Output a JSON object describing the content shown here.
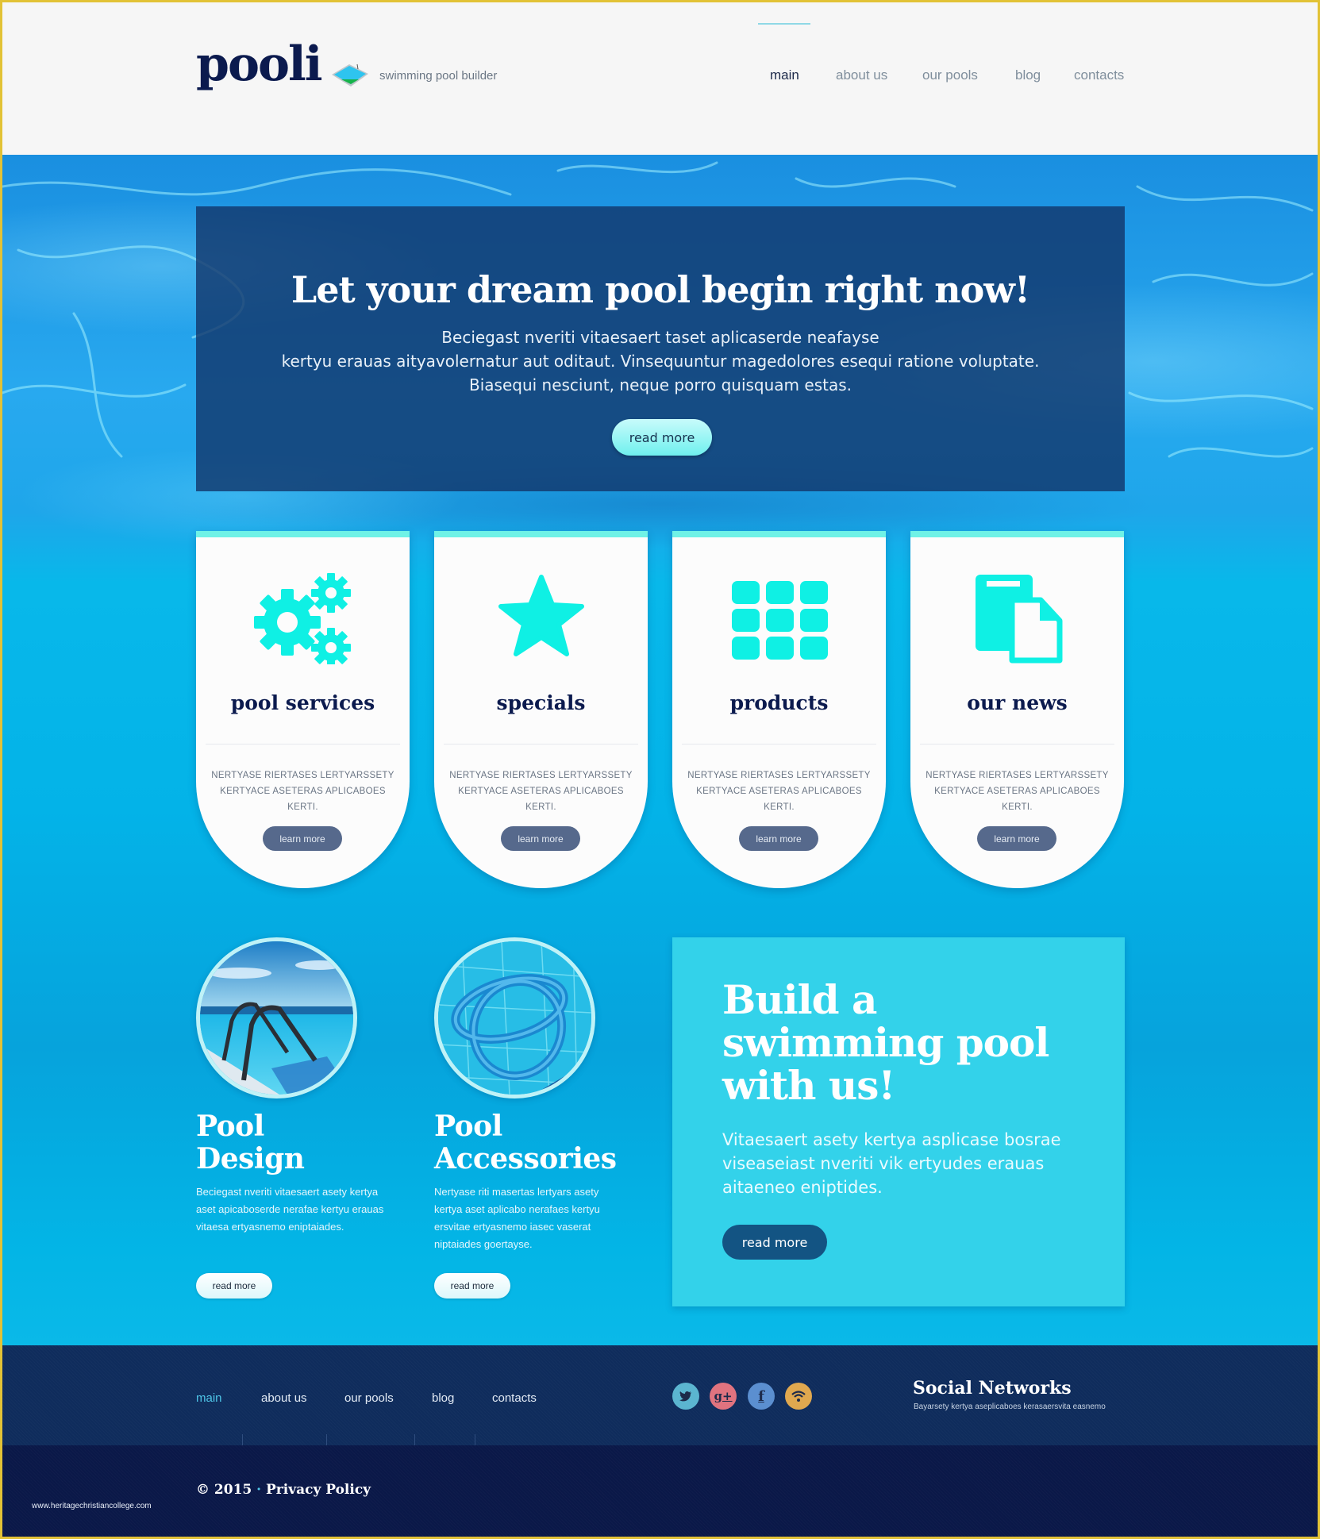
{
  "header": {
    "logo_text": "pooli",
    "logo_icon": "pool-diamond-icon",
    "tagline": "swimming pool builder",
    "nav": [
      {
        "label": "main",
        "active": true
      },
      {
        "label": "about us",
        "active": false
      },
      {
        "label": "our pools",
        "active": false
      },
      {
        "label": "blog",
        "active": false
      },
      {
        "label": "contacts",
        "active": false
      }
    ]
  },
  "hero": {
    "title": "Let your dream pool begin right now!",
    "text_lines": [
      "Beciegast nveriti vitaesaert taset aplicaserde neafayse",
      "kertyu erauas aityavolernatur aut oditaut. Vinsequuntur magedolores esequi ratione voluptate.",
      "Biasequi nesciunt, neque porro quisquam estas."
    ],
    "button": "read more"
  },
  "cards": [
    {
      "icon": "gears-icon",
      "title": "pool services",
      "text": "NERTYASE RIERTASES LERTYARSSETY KERTYACE ASETERAS APLICABOES KERTI.",
      "button": "learn more"
    },
    {
      "icon": "star-icon",
      "title": "specials",
      "text": "NERTYASE RIERTASES LERTYARSSETY KERTYACE ASETERAS APLICABOES KERTI.",
      "button": "learn more"
    },
    {
      "icon": "grid-icon",
      "title": "products",
      "text": "NERTYASE RIERTASES LERTYARSSETY KERTYACE ASETERAS APLICABOES KERTI.",
      "button": "learn more"
    },
    {
      "icon": "documents-icon",
      "title": "our news",
      "text": "NERTYASE RIERTASES LERTYARSSETY KERTYACE ASETERAS APLICABOES KERTI.",
      "button": "learn more"
    }
  ],
  "features": [
    {
      "image": "pool-ladder-photo",
      "title_line1": "Pool",
      "title_line2": "Design",
      "text": "Beciegast nveriti vitaesaert asety kertya aset apicaboserde nerafae kertyu erauas vitaesa ertyasnemo eniptaiades.",
      "button": "read more"
    },
    {
      "image": "pool-hose-photo",
      "title_line1": "Pool",
      "title_line2": "Accessories",
      "text": "Nertyase riti masertas lertyars asety kertya aset aplicabo nerafaes kertyu ersvitae ertyasnemo iasec vaserat niptaiades goertayse.",
      "button": "read more"
    }
  ],
  "cta": {
    "title_lines": [
      "Build a",
      "swimming pool",
      "with us!"
    ],
    "text": "Vitaesaert asety kertya asplicase bosrae viseaseiast nveriti vik ertyudes erauas aitaeneo eniptides.",
    "button": "read more"
  },
  "footer": {
    "nav": [
      {
        "label": "main",
        "active": true
      },
      {
        "label": "about us",
        "active": false
      },
      {
        "label": "our pools",
        "active": false
      },
      {
        "label": "blog",
        "active": false
      },
      {
        "label": "contacts",
        "active": false
      }
    ],
    "social": [
      {
        "name": "twitter",
        "glyph": "🐦",
        "color": "#5bb5d0"
      },
      {
        "name": "google-plus",
        "glyph": "g+",
        "color": "#e0737f"
      },
      {
        "name": "facebook",
        "glyph": "f",
        "color": "#5b8fd0"
      },
      {
        "name": "rss",
        "glyph": "wifi",
        "color": "#e0a84f"
      }
    ],
    "social_title": "Social Networks",
    "social_subtitle": "Bayarsety kertya aseplicaboes kerasaersvita easnemo",
    "copyright_year": "© 2015",
    "copyright_sep": "·",
    "privacy": "Privacy Policy",
    "watermark": "www.heritagechristiancollege.com"
  },
  "colors": {
    "accent_cyan": "#6ff2e6",
    "icon_cyan": "#0ff0e4",
    "navy": "#0b1a4e",
    "cta_bg": "#33d2ea",
    "cta_button": "#135483",
    "card_button": "#56698c",
    "page_border": "#e2c236"
  }
}
